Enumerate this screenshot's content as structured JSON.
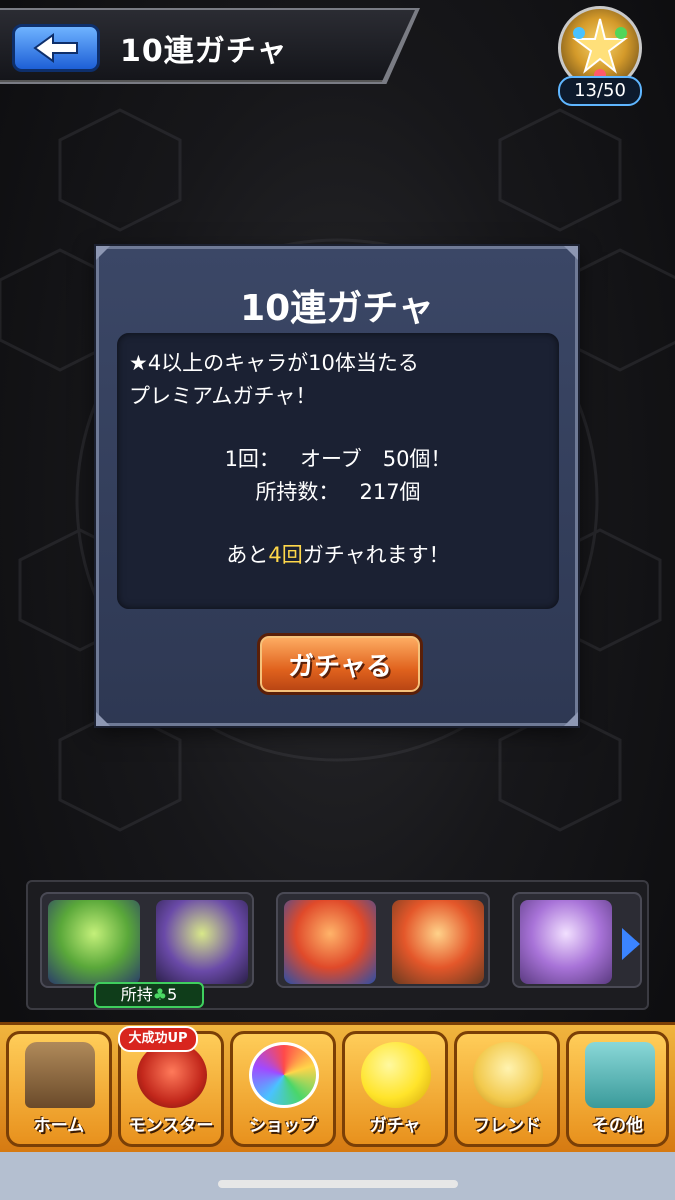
{
  "header": {
    "title": "10連ガチャ",
    "back_label": "back",
    "gem_counter": "13/50"
  },
  "dialog": {
    "title": "10連ガチャ",
    "description_line1": "★4以上のキャラが10体当たる",
    "description_line2": "プレミアムガチャ！",
    "cost_label": "1回：",
    "cost_value": "オーブ　50個！",
    "owned_label": "所持数：",
    "owned_value": "217個",
    "remaining_prefix": "あと",
    "remaining_count": "4回",
    "remaining_suffix": "ガチャれます！",
    "button_label": "ガチャる"
  },
  "roster": {
    "owned_badge_prefix": "所持",
    "owned_badge_icon": "clover-icon",
    "owned_badge_count": "5"
  },
  "nav": {
    "badge": "大成功UP",
    "items": [
      {
        "label": "ホーム",
        "icon": "home-icon"
      },
      {
        "label": "モンスター",
        "icon": "monster-icon"
      },
      {
        "label": "ショップ",
        "icon": "shop-icon"
      },
      {
        "label": "ガチャ",
        "icon": "gacha-icon"
      },
      {
        "label": "フレンド",
        "icon": "friend-icon"
      },
      {
        "label": "その他",
        "icon": "other-icon"
      }
    ]
  },
  "colors": {
    "highlight": "#ffd84a",
    "accent_blue": "#3b84ff",
    "button_orange": "#e0621d"
  }
}
